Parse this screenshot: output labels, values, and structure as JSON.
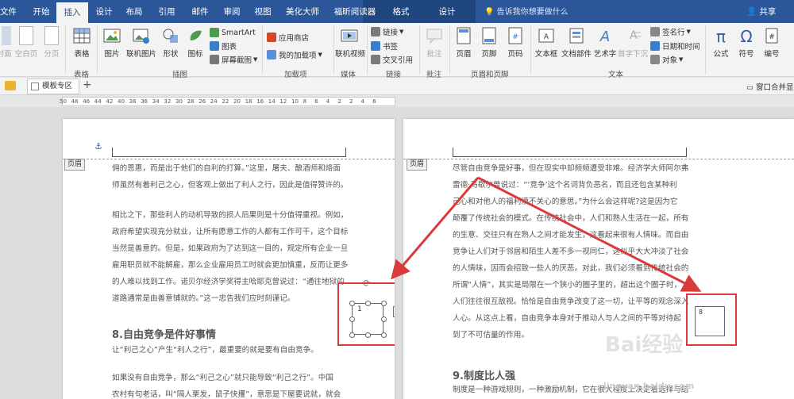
{
  "ribbon_tabs": [
    "文件",
    "开始",
    "插入",
    "设计",
    "布局",
    "引用",
    "邮件",
    "审阅",
    "视图",
    "美化大师",
    "福昕阅读器",
    "格式",
    "设计"
  ],
  "active_tab": "插入",
  "tell_me": "告诉我你想要做什么",
  "share": "共享",
  "ribbon": {
    "pages": {
      "cover": "封面",
      "blank": "空白页",
      "break": "分页"
    },
    "tables": {
      "table": "表格",
      "group": "表格"
    },
    "illustrations": {
      "picture": "图片",
      "online_picture": "联机图片",
      "shapes": "形状",
      "icons": "图标",
      "smartart": "SmartArt",
      "chart": "图表",
      "screenshot": "屏幕截图",
      "group": "插图"
    },
    "addins": {
      "store": "应用商店",
      "my_addins": "我的加载项",
      "group": "加载项"
    },
    "media": {
      "online_video": "联机视频",
      "group": "媒体"
    },
    "links": {
      "link": "链接",
      "bookmark": "书签",
      "cross_ref": "交叉引用",
      "group": "链接"
    },
    "comments": {
      "comment": "批注",
      "group": "批注"
    },
    "header_footer": {
      "header": "页眉",
      "footer": "页脚",
      "page_number": "页码",
      "group": "页眉和页脚"
    },
    "text": {
      "textbox": "文本框",
      "quick_parts": "文档部件",
      "wordart": "艺术字",
      "dropcap": "首字下沉",
      "signature": "签名行",
      "datetime": "日期和时间",
      "object": "对象",
      "group": "文本"
    },
    "symbols": {
      "equation": "公式",
      "symbol": "符号",
      "numbering": "编号"
    }
  },
  "tabstrip": {
    "template": "模板专区",
    "window_merge": "窗口合并显"
  },
  "ruler_numbers": [
    "50",
    "48",
    "46",
    "44",
    "42",
    "40",
    "38",
    "36",
    "34",
    "32",
    "30",
    "28",
    "26",
    "24",
    "22",
    "20",
    "18",
    "16",
    "14",
    "12",
    "10",
    "8",
    "6",
    "4",
    "2",
    "2",
    "4",
    "6"
  ],
  "left_page": {
    "header_label": "页眉",
    "lines1": [
      "佣的恩惠，而是出于他们的自利的打算。”这里，屠夫、酿酒师和烙面",
      "师虽然有着利己之心，但客观上做出了利人之行，因此是值得赞许的。"
    ],
    "lines2": [
      "相比之下，那些利人的动机导致的损人后果则是十分值得重视。例如，",
      "政府希望实现充分就业，让所有愿意工作的人都有工作可干，这个目标",
      "当然是善意的。但是，如果政府为了达到这一目的，规定所有企业一旦",
      "雇用职员就不能解雇，那么企业雇用员工时就会更加慎重，反而让更多",
      "的人难以找到工作。诺贝尔经济学奖得主哈耶克曾说过：“通往地狱的",
      "道路通常是由善意铺就的。”这一忠告我们应时刻谨记。"
    ],
    "heading": "8.自由竞争是件好事情",
    "line3": "让“利己之心”产生“利人之行”，最重要的就是要有自由竞争。",
    "lines4": [
      "如果没有自由竞争，那么“利己之心”就只能导致“利己之行”。中国",
      "农村有句老话，叫“隔人栗发，鼠子快攫”，意思是下屋要说就，就会"
    ],
    "textbox_char": "1"
  },
  "right_page": {
    "header_label": "页眉",
    "lines": [
      "尽管自由竞争是好事，但在现实中却频频遭受非难。经济学大师阿尔弗",
      "雷德·马歇尔曾说过：“‘竞争’这个名词背负恶名，而且还包含某种利",
      "己心和对他人的福利漠不关心的意思。”为什么会这样呢?这是因为它",
      "颠覆了传统社会的模式。在传统社会中，人们和熟人生活在一起，所有",
      "的生意、交往只有在熟人之间才能发生，这看起来很有人情味。而自由",
      "竞争让人们对于邻居和陌生人差不多一视同仁，这似乎大大冲淡了社会",
      "的人情味，因而会招致一些人的厌恶。对此，我们必须看到传统社会的",
      "所谓“人情”，其实是局限在一个狭小的圈子里的，超出这个圈子时，",
      "人们往往很互敌视。恰恰是自由竞争改变了这一切，让平等的观念深入",
      "人心。从这点上看，自由竞争本身对于推动人与人之间的平等对待起",
      "到了不可估量的作用。"
    ],
    "heading": "9.制度比人强",
    "line_last": "制度是一种游戏规则，一种激励机制，它在很大程度上决定着选择与结",
    "textbox_char": "8"
  },
  "watermark": {
    "main": "Bai经验",
    "url": "jingyan.baidu.com"
  },
  "colors": {
    "brand": "#2b579a",
    "annotation": "#d93a3a"
  }
}
